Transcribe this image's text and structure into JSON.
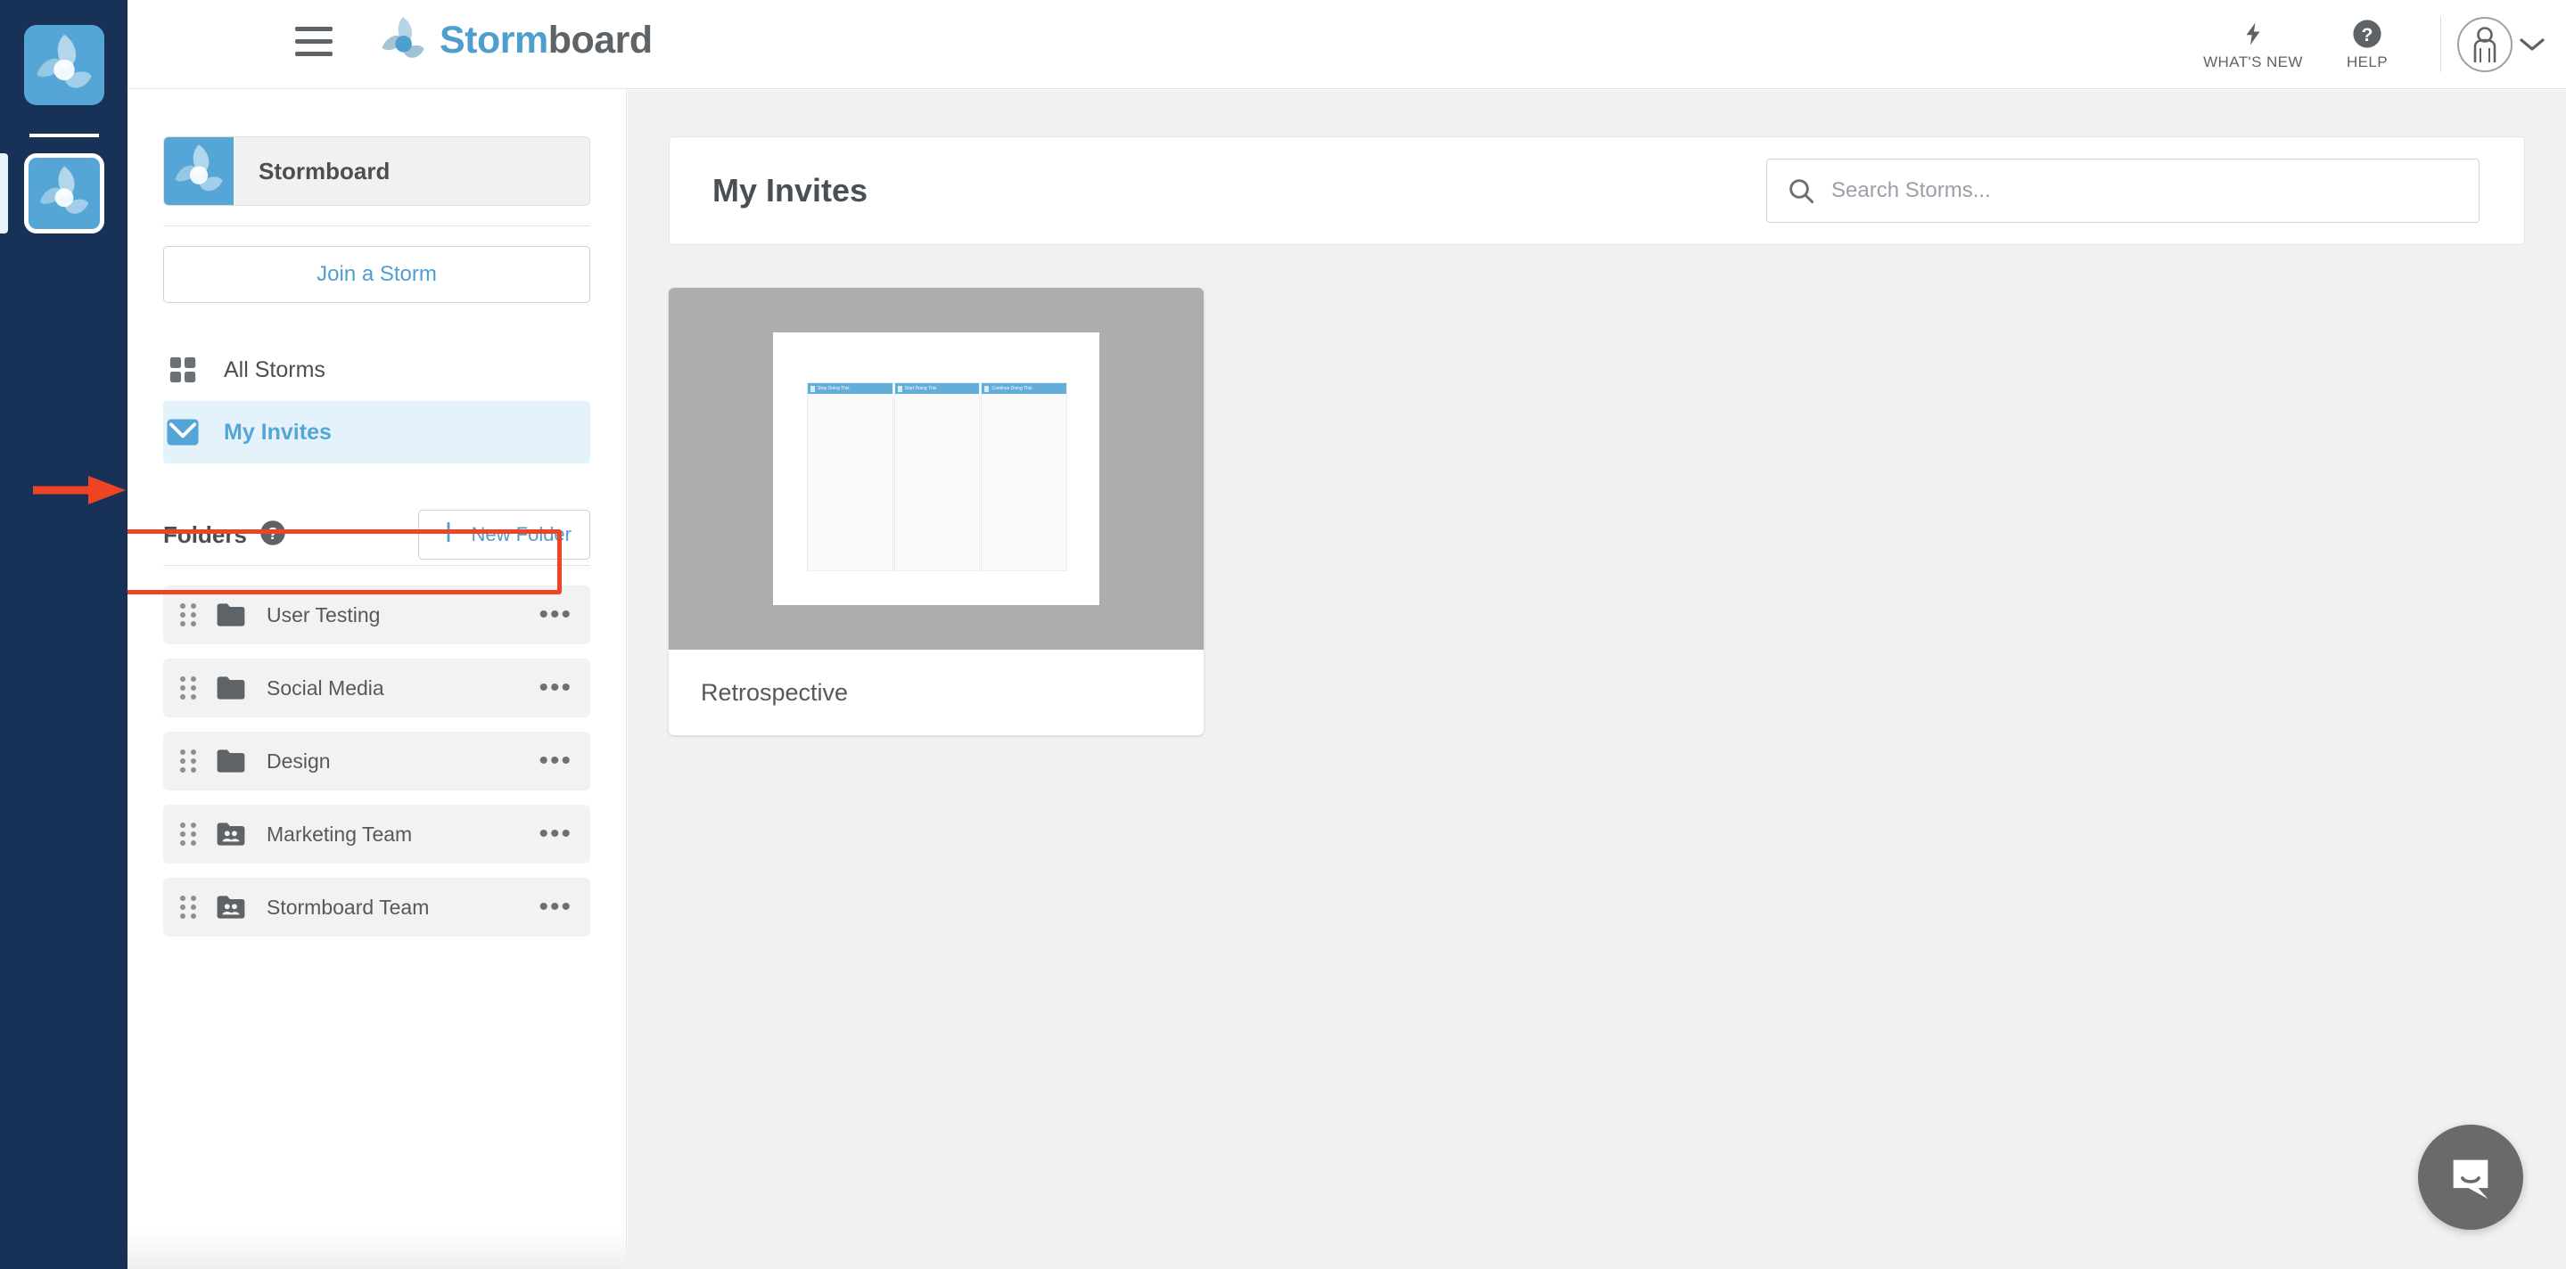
{
  "app": {
    "brand_primary": "Storm",
    "brand_secondary": "board",
    "accent_blue": "#55a6d6",
    "rail_navy": "#173157",
    "annotation_red": "#ef4423"
  },
  "header": {
    "menu_icon": "hamburger-menu-icon",
    "logo_icon": "stormboard-logo-icon",
    "whats_new_label": "WHAT'S NEW",
    "whats_new_icon": "lightning-bolt-icon",
    "help_label": "HELP",
    "help_icon": "question-mark-circle-icon",
    "avatar_icon": "user-avatar-icon",
    "chevron_icon": "chevron-down-icon"
  },
  "sidebar": {
    "org": {
      "name": "Stormboard",
      "icon": "stormboard-logo-icon"
    },
    "join_storm_label": "Join a Storm",
    "nav": [
      {
        "label": "All Storms",
        "icon": "grid-icon",
        "active": false
      },
      {
        "label": "My Invites",
        "icon": "envelope-icon",
        "active": true
      }
    ],
    "folders_heading": "Folders",
    "folders_help_icon": "question-mark-circle-icon",
    "new_folder_label": "New Folder",
    "new_folder_icon": "plus-icon",
    "folders": [
      {
        "name": "User Testing",
        "icon": "folder-icon"
      },
      {
        "name": "Social Media",
        "icon": "folder-icon"
      },
      {
        "name": "Design",
        "icon": "folder-icon"
      },
      {
        "name": "Marketing Team",
        "icon": "folder-team-icon"
      },
      {
        "name": "Stormboard Team",
        "icon": "folder-team-icon"
      }
    ],
    "row_menu_icon": "ellipsis-icon",
    "drag_handle_icon": "drag-handle-icon"
  },
  "main": {
    "page_title": "My Invites",
    "search": {
      "placeholder": "Search Storms...",
      "value": "",
      "icon": "search-icon"
    },
    "cards": [
      {
        "title": "Retrospective",
        "thumbnail_columns": [
          "Stop Doing This",
          "Start Doing This",
          "Continue Doing This"
        ]
      }
    ]
  },
  "annotation": {
    "arrow_icon": "right-arrow-annotation",
    "highlight_target": "My Invites"
  },
  "chat": {
    "icon": "chat-bubble-icon"
  }
}
